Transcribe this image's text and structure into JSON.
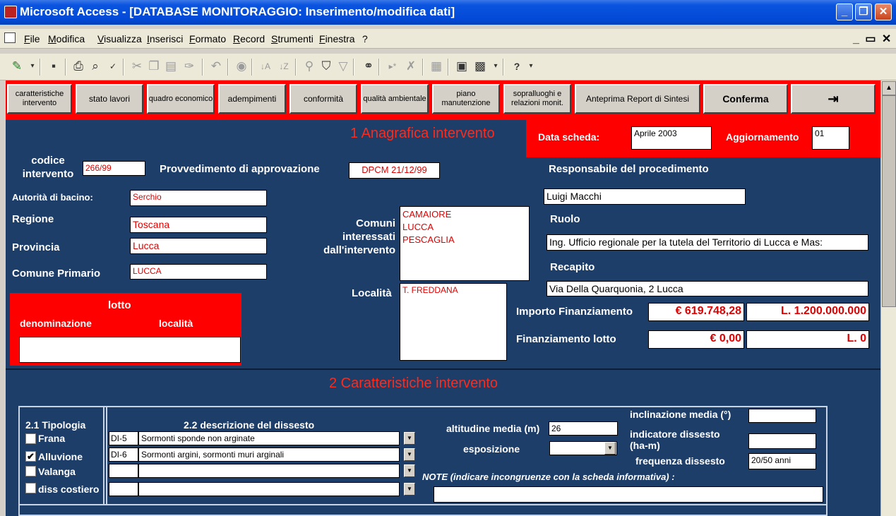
{
  "window": {
    "title": "Microsoft Access - [DATABASE MONITORAGGIO: Inserimento/modifica  dati]"
  },
  "menu": [
    "File",
    "Modifica",
    "Visualizza",
    "Inserisci",
    "Formato",
    "Record",
    "Strumenti",
    "Finestra",
    "?"
  ],
  "nav": {
    "b1": "caratteristiche intervento",
    "b2": "stato lavori",
    "b3": "quadro economico",
    "b4": "adempimenti",
    "b5": "conformità",
    "b6": "qualità ambientale",
    "b7": "piano manutenzione",
    "b8": "sopralluoghi e relazioni monit.",
    "b9": "Anteprima Report di Sintesi",
    "b10": "Conferma"
  },
  "section1": {
    "title": "1  Anagrafica intervento",
    "data_scheda_label": "Data scheda:",
    "data_scheda": "Aprile 2003",
    "aggiornamento_label": "Aggiornamento",
    "aggiornamento": "01",
    "codice_label": "codice intervento",
    "codice": "266/99",
    "provvedimento_label": "Provvedimento di approvazione",
    "provvedimento": "DPCM 21/12/99",
    "autorita_label": "Autorità di bacino:",
    "autorita": "Serchio",
    "regione_label": "Regione",
    "regione": "Toscana",
    "provincia_label": "Provincia",
    "provincia": "Lucca",
    "comune_label": "Comune Primario",
    "comune": "LUCCA",
    "comuni_label": "Comuni interessati dall'intervento",
    "comuni": [
      "CAMAIORE",
      "LUCCA",
      "PESCAGLIA"
    ],
    "localita_label": "Località",
    "localita": "T. FREDDANA",
    "responsabile_label": "Responsabile del procedimento",
    "responsabile": "Luigi Macchi",
    "ruolo_label": "Ruolo",
    "ruolo": "Ing. Ufficio regionale per la tutela del Territorio di Lucca e Mas:",
    "recapito_label": "Recapito",
    "recapito": "Via Della Quarquonia, 2  Lucca",
    "importo_label": "Importo Finanziamento",
    "importo_eur": "€ 619.748,28",
    "importo_lire": "L. 1.200.000.000",
    "fin_lotto_label": "Finanziamento lotto",
    "fin_lotto_eur": "€ 0,00",
    "fin_lotto_lire": "L. 0",
    "lotto": {
      "title": "lotto",
      "denominazione": "denominazione",
      "localita": "località"
    }
  },
  "section2": {
    "title": "2  Caratteristiche intervento",
    "tipologia_label": "2.1 Tipologia",
    "tipologie": [
      {
        "label": "Frana",
        "checked": ""
      },
      {
        "label": "Alluvione",
        "checked": "✔"
      },
      {
        "label": "Valanga",
        "checked": ""
      },
      {
        "label": "diss costiero",
        "checked": ""
      }
    ],
    "descrizione_label": "2.2  descrizione del dissesto",
    "rows": [
      {
        "code": "DI-5",
        "desc": "Sormonti sponde non arginate"
      },
      {
        "code": "DI-6",
        "desc": "Sormonti argini, sormonti muri arginali"
      },
      {
        "code": "",
        "desc": ""
      },
      {
        "code": "",
        "desc": ""
      }
    ],
    "altitudine_label": "altitudine media (m)",
    "altitudine": "26",
    "esposizione_label": "esposizione",
    "esposizione": "",
    "inclinazione_label": "inclinazione media (°)",
    "inclinazione": "",
    "indicatore_label": "indicatore dissesto (ha-m)",
    "indicatore": "",
    "frequenza_label": "frequenza dissesto",
    "frequenza": "20/50 anni",
    "note_label": "NOTE (indicare incongruenze con la scheda informativa) :",
    "note": ""
  }
}
